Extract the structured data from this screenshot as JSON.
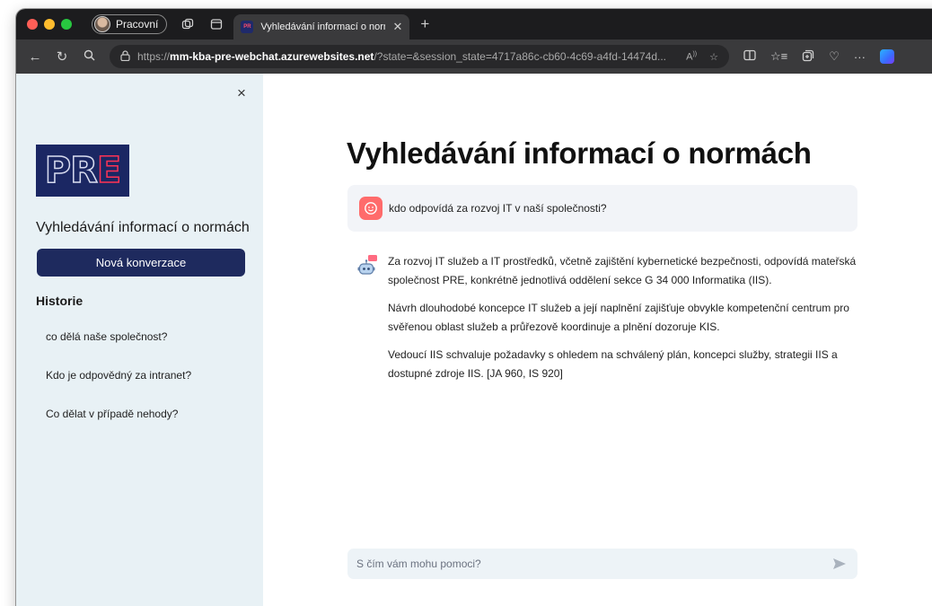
{
  "browser": {
    "profile_label": "Pracovní",
    "tab_title": "Vyhledávání informací o normác",
    "tab_favicon_text": "PR",
    "url": {
      "scheme": "https://",
      "host": "mm-kba-pre-webchat.azurewebsites.net",
      "rest": "/?state=&session_state=4717a86c-cb60-4c69-a4fd-14474d..."
    },
    "more_label": "···"
  },
  "sidebar": {
    "close_label": "×",
    "logo_text_a": "PR",
    "logo_text_b": "E",
    "title": "Vyhledávání informací o normách",
    "new_conversation_label": "Nová konverzace",
    "history_title": "Historie",
    "history": [
      "co dělá naše společnost?",
      "Kdo je odpovědný za intranet?",
      "Co dělat v případě nehody?"
    ]
  },
  "main": {
    "title": "Vyhledávání informací o normách",
    "user_message": "kdo odpovídá za rozvoj IT v naší společnosti?",
    "assistant_paragraphs": [
      "Za rozvoj IT služeb a IT prostředků, včetně zajištění kybernetické bezpečnosti, odpovídá mateřská společnost PRE, konkrétně jednotlivá oddělení sekce G 34 000 Informatika (IIS).",
      "Návrh dlouhodobé koncepce IT služeb a její naplnění zajišťuje obvykle kompetenční centrum pro svěřenou oblast služeb a průřezově koordinuje a plnění dozoruje KIS.",
      "Vedoucí IIS schvaluje požadavky s ohledem na schválený plán, koncepci služby, strategii IIS a dostupné zdroje IIS. [JA 960, IS 920]"
    ],
    "input_placeholder": "S čím vám mohu pomoci?"
  },
  "colors": {
    "sidebar_bg": "#e8f1f5",
    "primary_button": "#1e2a5e",
    "user_avatar": "#ff6b6b",
    "logo_bg": "#1b2763",
    "logo_accent": "#ff3355"
  },
  "icons": {
    "user_avatar": "smiley-face-icon",
    "assistant_avatar": "robot-icon",
    "send": "send-arrow-icon"
  }
}
